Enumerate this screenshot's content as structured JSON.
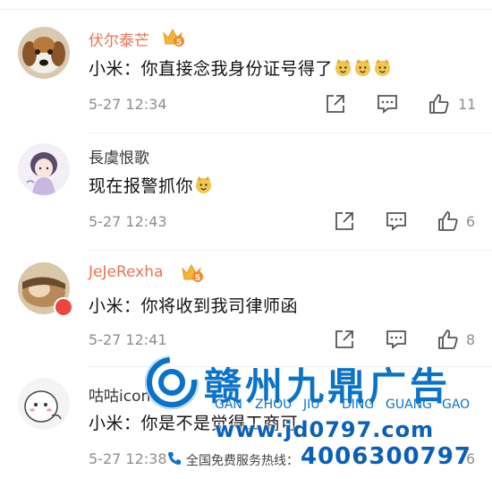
{
  "comments": [
    {
      "username": "伏尔泰芒",
      "text": "小米：你直接念我身份证号得了",
      "emoji_count": 3,
      "time": "5-27 12:34",
      "likes": "11",
      "vip": true,
      "name_color": "#eb7350"
    },
    {
      "username": "長虞恨歌",
      "text": "现在报警抓你",
      "emoji_count": 1,
      "time": "5-27 12:43",
      "likes": "6",
      "vip": false,
      "name_color": "#333333"
    },
    {
      "username": "JeJeRexha",
      "text": "小米：你将收到我司律师函",
      "emoji_count": 0,
      "time": "5-27 12:41",
      "likes": "8",
      "vip": true,
      "name_color": "#eb7350"
    },
    {
      "username": "咕咕icon",
      "text": "小米：你是不是觉得工商可",
      "emoji_count": 0,
      "time": "5-27 12:38",
      "likes": "6",
      "vip": false,
      "name_color": "#333333"
    }
  ],
  "watermark": {
    "brand": "赣州九鼎广告",
    "pinyin": [
      "GAN",
      "ZHOU",
      "JIU",
      "DING",
      "GUANG",
      "GAO"
    ],
    "url": "www.jd0797.com",
    "hotline_label": "全国免费服务热线：",
    "phone": "4006300797",
    "color": "#0a73c9"
  },
  "icons": [
    "share-icon",
    "comment-icon",
    "like-icon",
    "doge-emoji-icon",
    "vip-crown-icon"
  ]
}
